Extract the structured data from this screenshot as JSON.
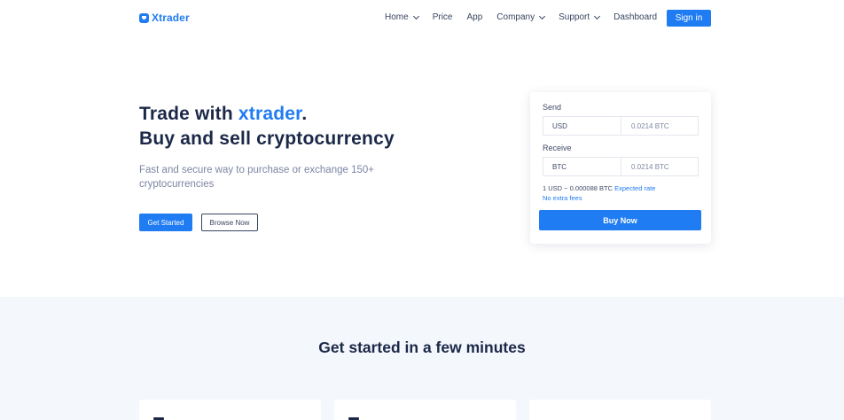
{
  "brand": {
    "name": "Xtrader",
    "icon": "xtrader-logo-icon",
    "color": "#1f7cf2"
  },
  "nav": {
    "items": [
      {
        "label": "Home",
        "has_dropdown": true
      },
      {
        "label": "Price",
        "has_dropdown": false
      },
      {
        "label": "App",
        "has_dropdown": false
      },
      {
        "label": "Company",
        "has_dropdown": true
      },
      {
        "label": "Support",
        "has_dropdown": true
      },
      {
        "label": "Dashboard",
        "has_dropdown": false
      }
    ],
    "signin_label": "Sign in"
  },
  "hero": {
    "title_prefix": "Trade with ",
    "title_accent": "xtrader",
    "title_suffix": ".",
    "title_line2": "Buy and sell cryptocurrency",
    "subtitle": "Fast and secure way to purchase or exchange 150+ cryptocurrencies",
    "primary_button": "Get Started",
    "secondary_button": "Browse Now"
  },
  "exchange": {
    "send_label": "Send",
    "send_currency": "USD",
    "send_amount": "0.0214 BTC",
    "receive_label": "Receive",
    "receive_currency": "BTC",
    "receive_amount": "0.0214 BTC",
    "rate_text": "1 USD ~ 0.000088 BTC",
    "rate_link": "Expected rate",
    "fees_text": "No extra fees",
    "buy_button": "Buy Now"
  },
  "section2": {
    "title": "Get started in a few minutes"
  },
  "colors": {
    "accent": "#1f7cf2",
    "heading": "#1b2848",
    "muted": "#7a86a2",
    "section_bg": "#f4f7fb"
  }
}
